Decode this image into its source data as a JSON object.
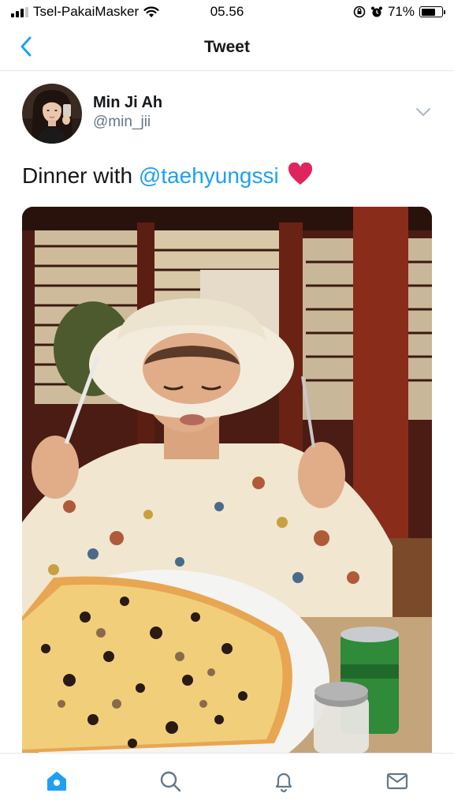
{
  "status_bar": {
    "carrier": "Tsel-PakaiMasker",
    "time": "05.56",
    "battery_percent": "71%",
    "battery_level": 0.71,
    "icons": [
      "signal-icon",
      "wifi-icon",
      "orientation-lock-icon",
      "alarm-icon",
      "battery-icon"
    ]
  },
  "nav": {
    "title": "Tweet",
    "back_icon": "chevron-left-icon"
  },
  "tweet": {
    "author_name": "Min Ji Ah",
    "author_handle": "@min_jii",
    "text_prefix": "Dinner with ",
    "mention": "@taehyungssi",
    "emoji": "red-heart-icon",
    "menu_icon": "chevron-down-icon"
  },
  "tab_bar": {
    "tabs": [
      {
        "icon": "home-icon",
        "active": true
      },
      {
        "icon": "search-icon",
        "active": false
      },
      {
        "icon": "notifications-icon",
        "active": false
      },
      {
        "icon": "messages-icon",
        "active": false
      }
    ]
  },
  "colors": {
    "accent": "#1da1f2",
    "text_primary": "#14171a",
    "text_secondary": "#657786",
    "divider": "#e1e8ed",
    "heart": "#e0245e"
  }
}
